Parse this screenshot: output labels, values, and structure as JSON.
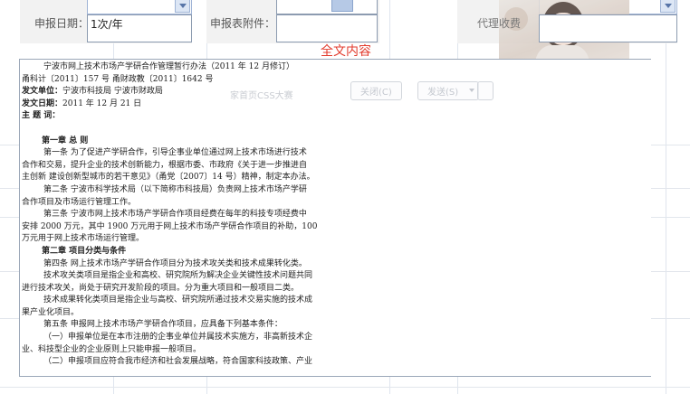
{
  "form": {
    "report_date_label": "申报日期：",
    "report_date_value": "1次/年",
    "attachment_label": "申报表附件：",
    "attachment_value": "",
    "agent_fee_label": "代理收费",
    "agent_fee_value": ""
  },
  "section_title": "全文内容",
  "overlay": {
    "close_label": "关闭(C)",
    "send_label": "发送(S)",
    "contest_text": "家首页CSS大赛"
  },
  "document": {
    "lines": [
      {
        "t": "宁波市网上技术市场产学研合作管理暂行办法（2011 年 12 月修订）",
        "c": "ind"
      },
      {
        "t": "甬科计〔2011〕157 号 甬财政教〔2011〕1642 号",
        "c": ""
      },
      {
        "k": "发文单位：",
        "t": "宁波市科技局 宁波市财政局",
        "c": ""
      },
      {
        "k": "发文日期：",
        "t": "2011 年 12 月 21 日",
        "c": ""
      },
      {
        "k": "主 题 词：",
        "t": "",
        "c": ""
      },
      {
        "t": "",
        "c": ""
      },
      {
        "t": "第一章 总 则",
        "c": "chap"
      },
      {
        "t": "第一条 为了促进产学研合作，引导企事业单位通过网上技术市场进行技术",
        "c": "ind"
      },
      {
        "t": "合作和交易，提升企业的技术创新能力，根据市委、市政府《关于进一步推进自",
        "c": ""
      },
      {
        "t": "主创新 建设创新型城市的若干意见》（甬党〔2007〕14 号）精神，制定本办法。",
        "c": ""
      },
      {
        "t": "第二条 宁波市科学技术局（以下简称市科技局）负责网上技术市场产学研",
        "c": "ind"
      },
      {
        "t": "合作项目及市场运行管理工作。",
        "c": ""
      },
      {
        "t": "第三条 宁波市网上技术市场产学研合作项目经费在每年的科技专项经费中",
        "c": "ind"
      },
      {
        "t": "安排 2000 万元，其中 1900 万元用于网上技术市场产学研合作项目的补助，100",
        "c": ""
      },
      {
        "t": "万元用于网上技术市场运行管理。",
        "c": ""
      },
      {
        "t": "第二章 项目分类与条件",
        "c": "chap"
      },
      {
        "t": "第四条 网上技术市场产学研合作项目分为技术攻关类和技术成果转化类。",
        "c": "ind"
      },
      {
        "t": "技术攻关类项目是指企业和高校、研究院所为解决企业关键性技术问题共同",
        "c": "ind"
      },
      {
        "t": "进行技术攻关，尚处于研究开发阶段的项目。分为重大项目和一般项目二类。",
        "c": ""
      },
      {
        "t": "技术成果转化类项目是指企业与高校、研究院所通过技术交易实施的技术成",
        "c": "ind"
      },
      {
        "t": "果产业化项目。",
        "c": ""
      },
      {
        "t": "第五条 申报网上技术市场产学研合作项目，应具备下列基本条件：",
        "c": "ind"
      },
      {
        "t": "（一）申报单位是在本市注册的企事业单位并属技术实施方，非高新技术企",
        "c": "ind"
      },
      {
        "t": "业、科技型企业的企业原则上只能申报一般项目。",
        "c": ""
      },
      {
        "t": "（二）申报项目应符合我市经济和社会发展战略，符合国家科技政策、产业",
        "c": "ind"
      }
    ]
  }
}
